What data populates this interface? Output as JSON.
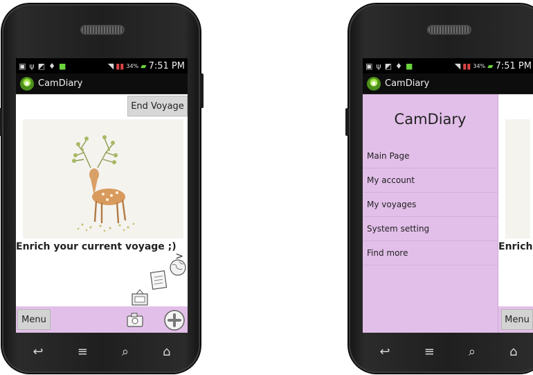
{
  "status_bar": {
    "battery": "34%",
    "time": "7:51 PM"
  },
  "app": {
    "title": "CamDiary"
  },
  "main": {
    "end_voyage_label": "End Voyage",
    "prompt": "Enrich your current voyage ;)",
    "next_arrow": ">",
    "menu_label": "Menu"
  },
  "drawer": {
    "title": "CamDiary",
    "items": [
      "Main Page",
      "My account",
      "My voyages",
      "System setting",
      "Find more"
    ]
  },
  "right_peek": {
    "prompt_fragment": "Enrich y",
    "menu_label": "Menu"
  }
}
